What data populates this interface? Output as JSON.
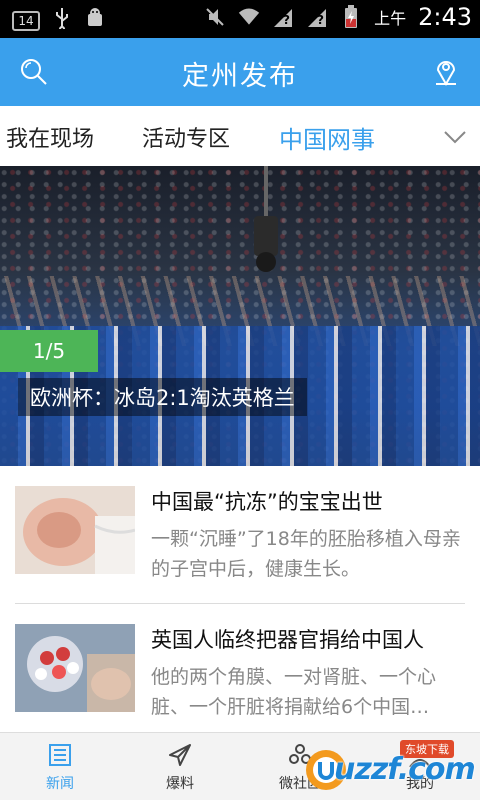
{
  "status_bar": {
    "notification_count": "14",
    "ampm": "上午",
    "time": "2:43",
    "icons": [
      "usb-icon",
      "android-debug-icon",
      "mute-icon",
      "wifi-icon",
      "signal-unknown-icon",
      "battery-charging-icon"
    ]
  },
  "header": {
    "title": "定州发布",
    "search_icon": "search-icon",
    "location_icon": "location-pin-icon"
  },
  "tabs": [
    {
      "label": "我在现场",
      "active": false
    },
    {
      "label": "活动专区",
      "active": false
    },
    {
      "label": "中国网事",
      "active": true
    }
  ],
  "hero": {
    "counter": "1/5",
    "caption": "欧洲杯：冰岛2:1淘汰英格兰"
  },
  "news": [
    {
      "title": "中国最“抗冻”的宝宝出世",
      "desc": "一颗“沉睡”了18年的胚胎移植入母亲的子宫中后，健康生长。"
    },
    {
      "title": "英国人临终把器官捐给中国人",
      "desc": "他的两个角膜、一对肾脏、一个心脏、一个肝脏将捐献给6个中国…"
    }
  ],
  "bottom_nav": [
    {
      "label": "新闻",
      "icon": "newspaper-icon",
      "active": true
    },
    {
      "label": "爆料",
      "icon": "paper-plane-icon",
      "active": false
    },
    {
      "label": "微社区",
      "icon": "community-icon",
      "active": false
    },
    {
      "label": "我的",
      "icon": "user-icon",
      "active": false
    }
  ],
  "watermark": {
    "text": "uzzf.com",
    "badge": "东坡下载"
  },
  "colors": {
    "accent": "#3aa0ec",
    "counter_green": "#4db557"
  }
}
